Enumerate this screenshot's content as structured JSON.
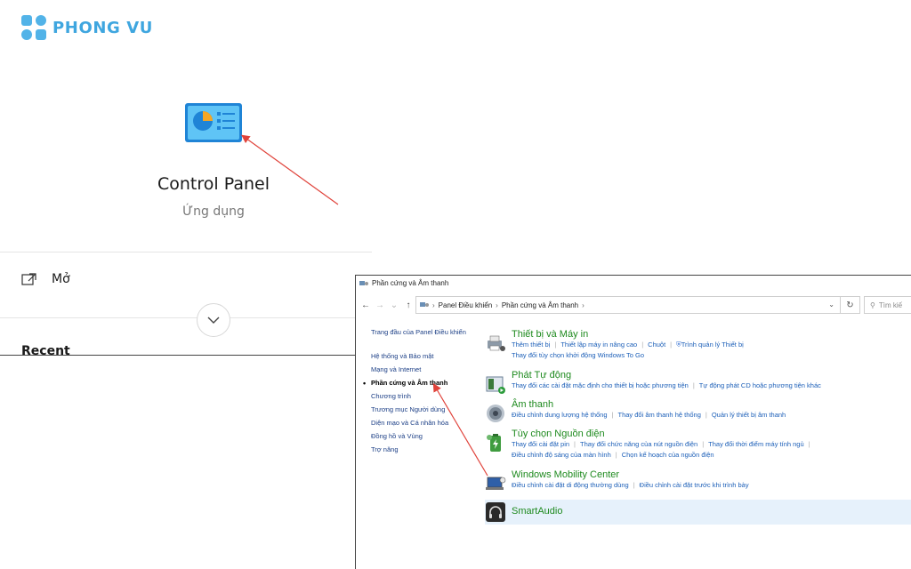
{
  "brand": {
    "name": "PHONG VU"
  },
  "search_result": {
    "app_name": "Control Panel",
    "app_type": "Ứng dụng",
    "open_label": "Mở",
    "recent_label": "Recent"
  },
  "control_panel": {
    "window_title": "Phần cứng và Âm thanh",
    "breadcrumb": [
      "Panel Điều khiển",
      "Phần cứng và Âm thanh"
    ],
    "search_placeholder": "Tìm kiế",
    "sidebar": {
      "home": "Trang đầu của Panel Điều khiển",
      "items": [
        "Hệ thống và Bảo mật",
        "Mạng và Internet",
        "Phần cứng và Âm thanh",
        "Chương trình",
        "Trương mục Người dùng",
        "Diện mạo và Cá nhân hóa",
        "Đồng hồ và Vùng",
        "Trợ năng"
      ],
      "active_index": 2
    },
    "categories": [
      {
        "title": "Thiết bị và Máy in",
        "icon": "printer-icon",
        "links": [
          [
            "Thêm thiết bị",
            "Thiết lập máy in nâng cao",
            "Chuột",
            "Trình quản lý Thiết bị"
          ],
          [
            "Thay đổi tùy chọn khởi động Windows To Go"
          ]
        ]
      },
      {
        "title": "Phát Tự động",
        "icon": "autoplay-icon",
        "links": [
          [
            "Thay đổi các cài đặt mặc định cho thiết bị hoặc phương tiện",
            "Tự động phát CD hoặc phương tiện khác"
          ]
        ]
      },
      {
        "title": "Âm thanh",
        "icon": "speaker-icon",
        "links": [
          [
            "Điều chỉnh dung lượng hệ thống",
            "Thay đổi âm thanh hệ thống",
            "Quản lý thiết bị âm thanh"
          ]
        ]
      },
      {
        "title": "Tùy chọn Nguồn điện",
        "icon": "battery-icon",
        "links": [
          [
            "Thay đổi cài đặt pin",
            "Thay đổi chức năng của nút nguồn điện",
            "Thay đổi thời điểm máy tính ngủ"
          ],
          [
            "Điều chỉnh độ sáng của màn hình",
            "Chọn kế hoạch của nguồn điện"
          ]
        ]
      },
      {
        "title": "Windows Mobility Center",
        "icon": "mobility-icon",
        "links": [
          [
            "Điều chỉnh cài đặt di động thường dùng",
            "Điều chỉnh cài đặt trước khi trình bày"
          ]
        ]
      }
    ],
    "smartaudio": {
      "title": "SmartAudio",
      "icon": "headphones-icon"
    }
  },
  "colors": {
    "brand": "#3fa6df",
    "category_title": "#1e8a1e",
    "link": "#1c5fb8",
    "annotation_arrow": "#e0433b"
  }
}
